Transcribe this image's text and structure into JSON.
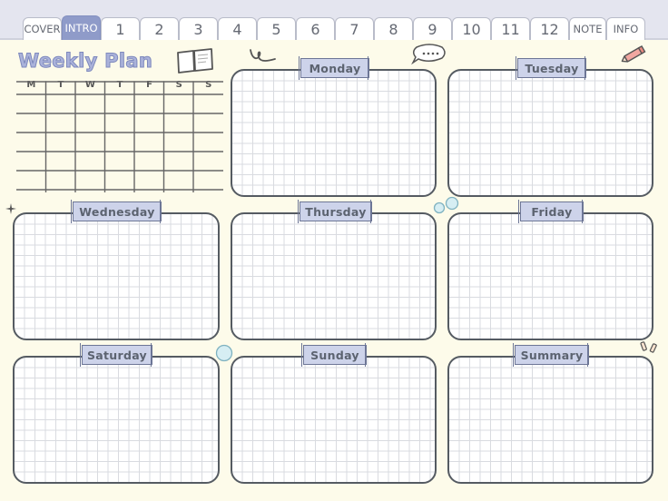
{
  "tabs": [
    {
      "label": "COVER",
      "kind": "word"
    },
    {
      "label": "INTRO",
      "kind": "word",
      "active": true
    },
    {
      "label": "1",
      "kind": "num"
    },
    {
      "label": "2",
      "kind": "num"
    },
    {
      "label": "3",
      "kind": "num"
    },
    {
      "label": "4",
      "kind": "num"
    },
    {
      "label": "5",
      "kind": "num"
    },
    {
      "label": "6",
      "kind": "num"
    },
    {
      "label": "7",
      "kind": "num"
    },
    {
      "label": "8",
      "kind": "num"
    },
    {
      "label": "9",
      "kind": "num"
    },
    {
      "label": "10",
      "kind": "num"
    },
    {
      "label": "11",
      "kind": "num"
    },
    {
      "label": "12",
      "kind": "num"
    },
    {
      "label": "NOTE",
      "kind": "word"
    },
    {
      "label": "INFO",
      "kind": "word"
    }
  ],
  "page": {
    "title": "Weekly Plan",
    "mini_calendar_headers": [
      "M",
      "T",
      "W",
      "T",
      "F",
      "S",
      "S"
    ],
    "days": {
      "monday": "Monday",
      "tuesday": "Tuesday",
      "wednesday": "Wednesday",
      "thursday": "Thursday",
      "friday": "Friday",
      "saturday": "Saturday",
      "sunday": "Sunday",
      "summary": "Summary"
    },
    "speech_bubble_text": "...."
  },
  "colors": {
    "background": "#fdfbea",
    "tab_active": "#8f9bc9",
    "label_fill": "#cdd3ea",
    "title_fill": "#aab2da",
    "box_border": "#555b62",
    "pencil": "#f1a7a0"
  }
}
